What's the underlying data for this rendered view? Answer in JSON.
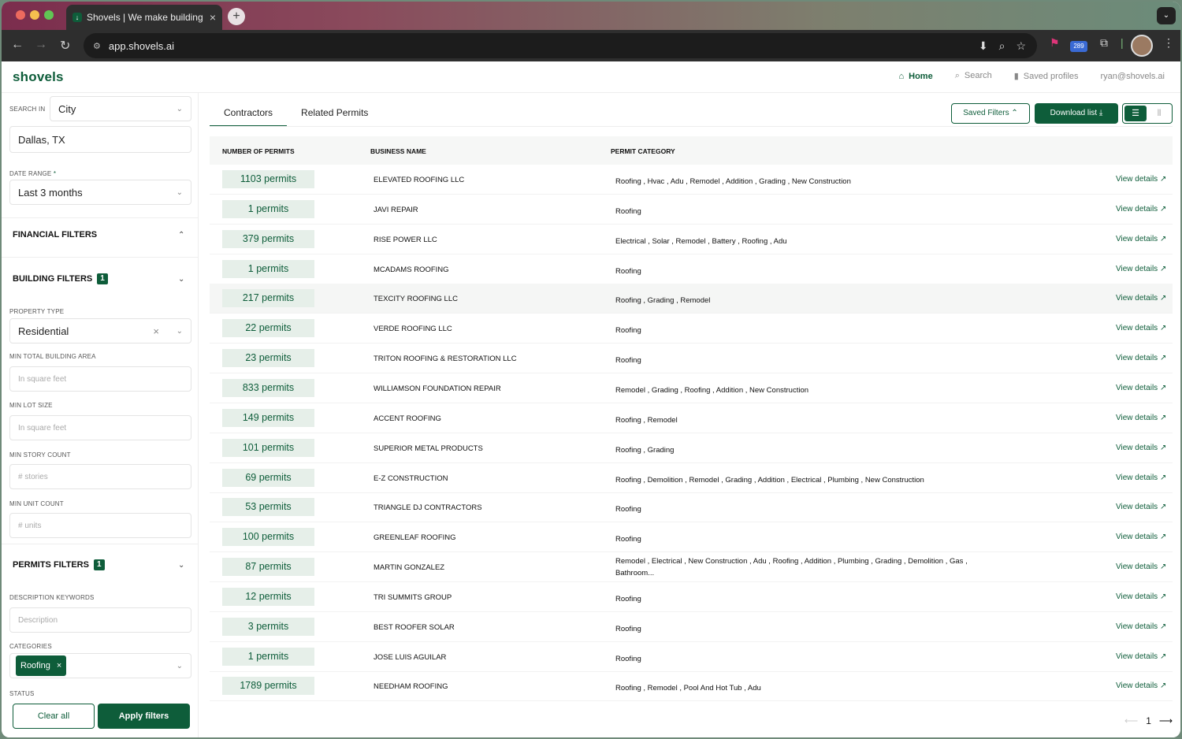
{
  "browser": {
    "tab_title": "Shovels | We make building p",
    "url": "app.shovels.ai",
    "ext_badge": "289"
  },
  "app": {
    "logo": "shovels",
    "nav": {
      "home": "Home",
      "search": "Search",
      "saved": "Saved profiles",
      "user": "ryan@shovels.ai"
    }
  },
  "sidebar": {
    "search_in_label": "SEARCH IN",
    "search_in_value": "City",
    "location": "Dallas, TX",
    "date_range_label": "DATE RANGE",
    "date_range_required": "*",
    "date_range_value": "Last 3 months",
    "financial_filters": "FINANCIAL FILTERS",
    "building_filters": "BUILDING FILTERS",
    "building_count": "1",
    "property_type_label": "PROPERTY TYPE",
    "property_type_value": "Residential",
    "min_area_label": "MIN TOTAL BUILDING AREA",
    "min_area_ph": "In square feet",
    "min_lot_label": "MIN LOT SIZE",
    "min_lot_ph": "In square feet",
    "min_story_label": "MIN STORY COUNT",
    "min_story_ph": "# stories",
    "min_unit_label": "MIN UNIT COUNT",
    "min_unit_ph": "# units",
    "permits_filters": "PERMITS FILTERS",
    "permits_count": "1",
    "desc_label": "DESCRIPTION KEYWORDS",
    "desc_ph": "Description",
    "categories_label": "CATEGORIES",
    "category_chip": "Roofing",
    "status_label": "STATUS",
    "clear_all": "Clear all",
    "apply": "Apply filters"
  },
  "main": {
    "tabs": [
      "Contractors",
      "Related Permits"
    ],
    "saved_filters": "Saved Filters",
    "download": "Download list",
    "columns": [
      "NUMBER OF PERMITS",
      "BUSINESS NAME",
      "PERMIT CATEGORY"
    ],
    "view_details": "View details",
    "rows": [
      {
        "permits": "1103 permits",
        "name": "ELEVATED ROOFING LLC",
        "category": "Roofing , Hvac , Adu , Remodel , Addition , Grading , New Construction"
      },
      {
        "permits": "1 permits",
        "name": "JAVI REPAIR",
        "category": "Roofing"
      },
      {
        "permits": "379 permits",
        "name": "RISE POWER LLC",
        "category": "Electrical , Solar , Remodel , Battery , Roofing , Adu"
      },
      {
        "permits": "1 permits",
        "name": "MCADAMS ROOFING",
        "category": "Roofing"
      },
      {
        "permits": "217 permits",
        "name": "TEXCITY ROOFING LLC",
        "category": "Roofing , Grading , Remodel"
      },
      {
        "permits": "22 permits",
        "name": "VERDE ROOFING LLC",
        "category": "Roofing"
      },
      {
        "permits": "23 permits",
        "name": "TRITON ROOFING & RESTORATION LLC",
        "category": "Roofing"
      },
      {
        "permits": "833 permits",
        "name": "WILLIAMSON FOUNDATION REPAIR",
        "category": "Remodel , Grading , Roofing , Addition , New Construction"
      },
      {
        "permits": "149 permits",
        "name": "ACCENT ROOFING",
        "category": "Roofing , Remodel"
      },
      {
        "permits": "101 permits",
        "name": "SUPERIOR METAL PRODUCTS",
        "category": "Roofing , Grading"
      },
      {
        "permits": "69 permits",
        "name": "E-Z CONSTRUCTION",
        "category": "Roofing , Demolition , Remodel , Grading , Addition , Electrical , Plumbing , New Construction"
      },
      {
        "permits": "53 permits",
        "name": "TRIANGLE DJ CONTRACTORS",
        "category": "Roofing"
      },
      {
        "permits": "100 permits",
        "name": "GREENLEAF ROOFING",
        "category": "Roofing"
      },
      {
        "permits": "87 permits",
        "name": "MARTIN GONZALEZ",
        "category": "Remodel , Electrical , New Construction , Adu , Roofing , Addition , Plumbing , Grading , Demolition , Gas , Bathroom..."
      },
      {
        "permits": "12 permits",
        "name": "TRI SUMMITS GROUP",
        "category": "Roofing"
      },
      {
        "permits": "3 permits",
        "name": "BEST ROOFER SOLAR",
        "category": "Roofing"
      },
      {
        "permits": "1 permits",
        "name": "JOSE LUIS AGUILAR",
        "category": "Roofing"
      },
      {
        "permits": "1789 permits",
        "name": "NEEDHAM ROOFING",
        "category": "Roofing , Remodel , Pool And Hot Tub , Adu"
      }
    ],
    "page": "1"
  }
}
